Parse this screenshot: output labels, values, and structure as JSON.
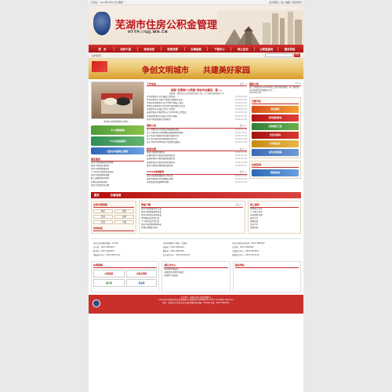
{
  "topbar": {
    "left": "今天是：2019年3月21日 星期一",
    "right": "设为首页 | 加入收藏 | 联系我们"
  },
  "header": {
    "title": "芜湖市住房公积金管理中心",
    "url": "HTTP://GJJ.WH.CN"
  },
  "nav": [
    "首　页",
    "机构介绍",
    "政务动态",
    "政策法规",
    "办事指南",
    "下载中心",
    "网上互动",
    "公积金查询",
    "服务导航"
  ],
  "search": {
    "label": "站内检索",
    "button": "搜索"
  },
  "slogan": {
    "left": "争创文明城市",
    "right": "共建美好家园"
  },
  "left": {
    "photo_caption": "市住房公积金管理中心领导……",
    "pills": [
      "个人贷款查询",
      "个人公积金查询",
      "住房公积金网上服务"
    ],
    "service_head": "便民服务",
    "service_links": [
      "住房公积金缴存比例调整",
      "住房公积金贷款利率",
      "住房公积金提取说明",
      "个人住房公积金贷款流程",
      "住房公积金缴存基数",
      "职工退休提取公积金",
      "异地贷款材料清单",
      "住房公积金常见问题"
    ]
  },
  "middle": {
    "news_head": "工作动态",
    "more": "更多>>",
    "headline": "加强“互联网+公积金”综合平台建设，使……",
    "subline": "加强事，做好住房公积金服务提升行动，扩大缴存使用群体工作",
    "news": [
      [
        "市公积金中心召开廉政工作会议……",
        "2019-03-20"
      ],
      [
        "市公积金中心开展‘学雷锋’志愿服务活动",
        "2019-03-18"
      ],
      [
        "市住房公积金中心召开全体干部职工会议",
        "2019-03-15"
      ],
      [
        "市住房公积金中心党支部开展主题党日活动",
        "2019-03-12"
      ],
      [
        "公积金中心开展安全生产大检查",
        "2019-03-10"
      ],
      [
        "芜湖市住房公积金中心召开2019年工作会议",
        "2019-03-06"
      ],
      [
        "公积金管理中心到县区分中心调研",
        "2019-03-02"
      ],
      [
        "住房公积金政策宣传进社区",
        "2019-02-26"
      ]
    ],
    "notice_head": "通知公告",
    "notices": [
      [
        "关于调整住房公积金贷款政策的通知",
        "2019-03-19"
      ],
      [
        "关于开展住房公积金缴存基数调整的通知",
        "2019-03-10"
      ],
      [
        "关于住房公积金业务系统升级的公告",
        "2019-03-01"
      ],
      [
        "关于春节期间业务办理时间的公告",
        "2019-01-28"
      ],
      [
        "关于公布2018年住房公积金年度报告",
        "2019-01-20"
      ]
    ],
    "policy_head": "政策法规",
    "policies": [
      [
        "住房公积金管理条例",
        "2019-01-05"
      ],
      [
        "安徽省住房公积金归集管理办法",
        "2018-12-20"
      ],
      [
        "芜湖市住房公积金提取管理办法",
        "2018-11-16"
      ],
      [
        "芜湖市住房公积金贷款管理办法",
        "2018-10-08"
      ],
      [
        "住房公积金异地转移接续办法",
        "2018-09-12"
      ]
    ],
    "hotline_head": "12329热线服务",
    "hotlines": [
      [
        "住房公积金热线服务平台问答",
        "2019-03-15"
      ],
      [
        "如何查询住房公积金缴存余额",
        "2019-03-02"
      ],
      [
        "公积金贷款需要哪些材料",
        "2019-02-18"
      ]
    ]
  },
  "right": {
    "login_head": "最新公告",
    "login_tab": "notice",
    "notice_text": "关于公积金中心2019年度工作安排的通知；关于规范住房公积金业务办理的公告……",
    "dates": "2019-03-20",
    "thumb_head": "专题专栏",
    "thumbs": [
      "精品楼盘",
      "党风廉政建设",
      "实事便民工程",
      "党员先锋岗",
      "作风建设年",
      "业务办理指南"
    ],
    "work_head": "在线咨询",
    "work_btn": "我要咨询"
  },
  "band": {
    "a": "服务",
    "b": "办事指南"
  },
  "lower": {
    "a_head": "业务办理流程",
    "a_btns": [
      "缴存",
      "提取",
      "贷款",
      "转移",
      "查询",
      "下载"
    ],
    "a_head2": "咨询电话",
    "b_head": "表格下载",
    "b_items": [
      "住房公积金缴存登记表",
      "住房公积金提取申请表",
      "住房公积金贷款申请表",
      "单位缴存变更登记表",
      "个人账户设立登记表",
      "住房公积金转移申请表",
      "异地贷款缴存证明"
    ],
    "c_head": "网上服务",
    "c_items": [
      "单位网上业务",
      "个人网上业务",
      "贷款进度查询",
      "政务公开",
      "办事指南",
      "信息公开",
      "在线咨询"
    ]
  },
  "footinfo": [
    "住房公积金服务热线：12329",
    "公积金管理中心地址：芜湖市",
    "住房公积金业务咨询：0553-3863697",
    "办公室：0553-3863521",
    "归集科：0553-3863529",
    "信贷科：0553-3863580",
    "财务科：0553-3863507",
    "稽核科：0553-3863526",
    "芜湖县分中心：0553-5803107",
    "南陵县分中心：0553-6813112",
    "无为县分中心：0553-6332115",
    "繁昌县分中心：0553-7872116"
  ],
  "links": {
    "head1": "友情链接",
    "head2": "县区分中心",
    "head3": "相关网站",
    "logos": [
      "中国芜湖",
      "中国文明网",
      "皖户网",
      "黄金网"
    ],
    "side": [
      "住房城乡建设部",
      "安徽省住房城乡建设厅",
      "芜湖市人民政府"
    ]
  },
  "copyright": [
    "主办单位：芜湖市住房公积金管理中心",
    "Copyright 芜湖市住房公积金管理中心 版权所有 皖ICP备05011234号 All Rights Reserved",
    "地址：芜湖市九华中路 住房公积金管理大厦 邮编：241000 电话：0553-3863697"
  ]
}
